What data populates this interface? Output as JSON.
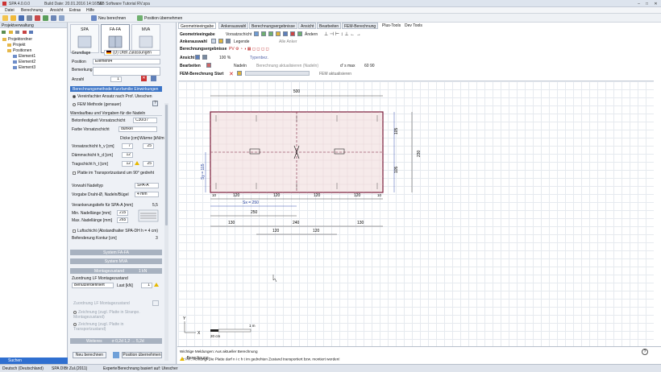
{
  "window": {
    "title": "SPA 4.0.0.0",
    "build": "Build Date: 20.01.2016 14:16:56",
    "app_name": "T&B Software Tutorial RV.spa",
    "controls": [
      "–",
      "□",
      "✕"
    ]
  },
  "menu": [
    "Datei",
    "Berechnung",
    "Ansicht",
    "Extras",
    "Hilfe"
  ],
  "toolbar": {
    "new_calc": "Neu berechnen",
    "apply_position": "Position übernehmen"
  },
  "project_panel": {
    "title": "Projektverwaltung",
    "tree": [
      {
        "label": "Projektordner",
        "level": 0
      },
      {
        "label": "Projekt",
        "level": 1
      },
      {
        "label": "Positionen",
        "level": 1
      },
      {
        "label": "Element1",
        "level": 2
      },
      {
        "label": "Element2",
        "level": 2
      },
      {
        "label": "Element3",
        "level": 2
      }
    ],
    "search": "Suchen"
  },
  "mid_panel": {
    "modes": [
      "SPA",
      "FA-FA",
      "MVA"
    ],
    "grundlage_label": "Grundlage",
    "grundlage_value": "(D) DIBt Zulassungen",
    "position_label": "Position",
    "position_value": "Element4",
    "bemerkung_label": "Bemerkung",
    "anzahl_label": "Anzahl",
    "anzahl_value": "1",
    "method_header": "Berechnungsmethode Kurzfamilie Einwirkungen",
    "radio1": "Vereinfachter Ansatz nach Prof. Uteschen",
    "radio2": "FEM Methode (genauer)",
    "wand_header": "Wandaufbau und Vorgaben für die Nadeln",
    "beton_label": "Betonfestigkeit Vorsatzschicht",
    "beton_value": "C30/37",
    "farbe_label": "Farbe Vorsatzschicht",
    "farbe_value": "dunkel",
    "col_dicke": "Dicke [cm]",
    "col_waerme": "Wärme [kN/m³]",
    "vorsatz_label": "Vorsatzschicht  h_v  [cm]",
    "vorsatz_dicke": "7",
    "vorsatz_w": "25",
    "daemm_label": "Dämmschicht  h_d  [cm]",
    "daemm_dicke": "12",
    "trag_label": "Tragschicht  h_t  [cm]",
    "trag_dicke": "12",
    "trag_w": "25",
    "platte_chk": "Platte im Transportzustand um 90° gedreht",
    "nadeltyp_label": "Vorwahl Nadeltyp",
    "nadeltyp_value": "SPA-A",
    "draht_label": "Vorgabe Draht-Ø, Nadeln/Bügel",
    "draht_value": "4 mm",
    "verank_label": "Verankerungstiefe für SPA-A  [mm]",
    "verank_value": "5,5",
    "min_label": "Min. Nadellänge [mm]",
    "min_value": "215",
    "max_label": "Max. Nadellänge [mm]",
    "max_value": "265",
    "luft_chk": "Luftschicht (Abstandhalter SPA-DH  h = 4 cm)",
    "kontur_label": "Befenderung Kontur  [cm]",
    "kontur_value": "3",
    "sys_fa": "System FA-FA",
    "sys_mva": "System MVA",
    "montage_header": "Montagezustand",
    "montage_code": "1 kN",
    "zusatz_label": "Zuordnung LF Montagezustand",
    "zusatz_value": "Benutzerdefiniert",
    "last_label": "Last  [kN]",
    "last_value": "1",
    "dis1": "Zuordnung LF Montagezustand",
    "dis2": "Zeichnung (zugl. Platte in Stranpo. Montagezustand)",
    "dis3": "Zeichnung (zugl. Platte in Transportzustand)",
    "weitere": "Weiteres",
    "weitere_code": "σ 0,2d  1,2  → 5,2d",
    "btn_neu": "Neu berechnen",
    "btn_pos": "Position übernehmen"
  },
  "tabs": [
    "Geometrieeingabe",
    "Ankerauswahl",
    "Berechnungsergebnisse",
    "Ansicht",
    "Bearbeiten",
    "FEM-Berechnung",
    "Plus-Tools",
    "Dev Tools"
  ],
  "ribbon": {
    "geo": "Geometrieeingabe",
    "vorsatz": "Vorsatzschicht",
    "aendern": "Ändern",
    "anker": "Ankerauswahl",
    "legende": "Legende",
    "alle_anker": "Alle Anker",
    "ergebnisse": "Berechnungsergebnisse",
    "ansicht": "Ansicht",
    "zoom": "100 %",
    "typ": "Typenbez.",
    "bearbeiten": "Bearbeiten",
    "nadeln": "Nadeln",
    "aktualisieren": "Berechnung aktualisieren (Nadeln)",
    "max": "d' s max",
    "max_vals": "60  90",
    "fem": "FEM-Berechnung",
    "start": "Start",
    "fem_akt": "FEM aktualisieren"
  },
  "drawing": {
    "width_dim": "500",
    "height_dim": "230",
    "right_dim1": "105",
    "right_dim2": "105",
    "sx": "Sx = 250",
    "sy": "Sy = 115",
    "bottom_dims1": [
      "10",
      "120",
      "120",
      "120",
      "120",
      "10"
    ],
    "dim_250": "250",
    "dims_130": [
      "130",
      "240",
      "130"
    ],
    "dims_120": [
      "120",
      "120"
    ],
    "scale": "20 cm",
    "scale_m": "1 m"
  },
  "messages": {
    "title": "Wichtige Meldungen: Aus aktueller Berechnung",
    "line1": "FA : Achtung: Die Platte darf  n i c h t  im gedrehten Zustand transportiert bzw. montiert werden!",
    "line2": "FA : Die Montagezusatzlast ist nur für den Montagezustand berücksichtigt."
  },
  "bottom_tab": "Berechnung",
  "status": {
    "lang": "Deutsch (Deutschland)",
    "norm": "SPA DIBt Zul.(2011)",
    "mode": "Experte",
    "info": "Berechnung basiert auf: Utescher"
  }
}
